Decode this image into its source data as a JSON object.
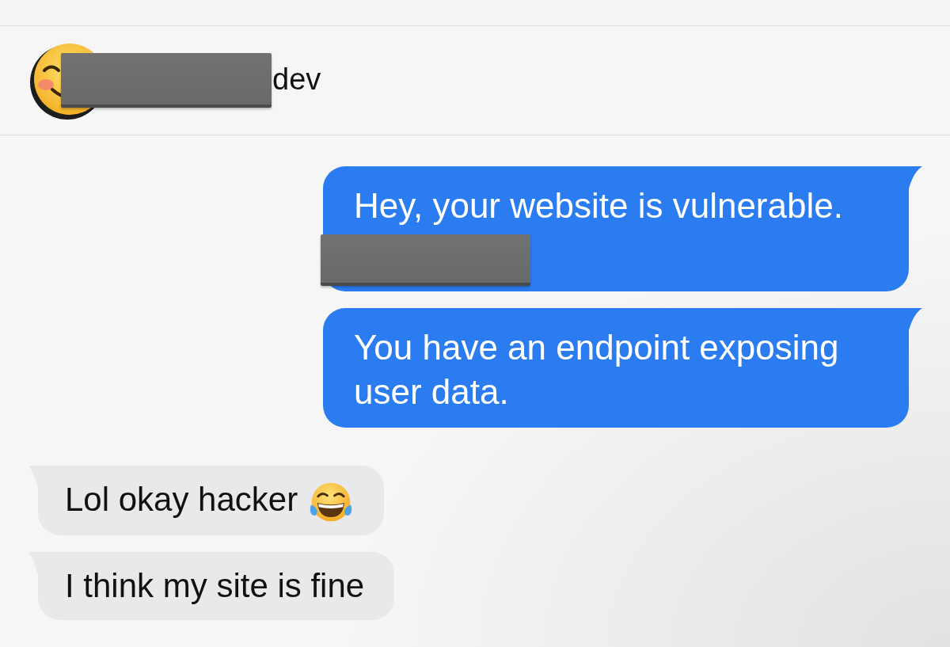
{
  "header": {
    "name": [
      {
        "kind": "redacted"
      },
      {
        "kind": "text",
        "text": "dev"
      }
    ]
  },
  "messages": [
    {
      "kind": "sent",
      "parts": [
        {
          "kind": "text",
          "text": "Hey, your website is vulnerable."
        },
        {
          "kind": "redacted"
        }
      ]
    },
    {
      "kind": "sent",
      "parts": [
        {
          "kind": "text",
          "text": "You have an endpoint exposing user data."
        }
      ]
    },
    {
      "kind": "received",
      "parts": [
        {
          "kind": "text",
          "text": "Lol okay hacker"
        },
        {
          "kind": "emoji"
        }
      ]
    },
    {
      "kind": "received",
      "parts": [
        {
          "kind": "text",
          "text": "I think my site is fine"
        }
      ]
    }
  ]
}
